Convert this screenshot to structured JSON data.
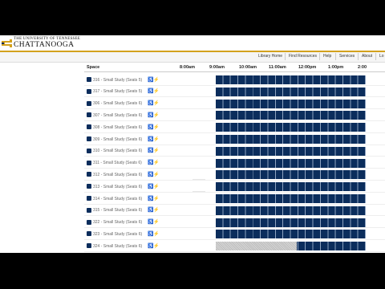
{
  "logo": {
    "top_text": "THE UNIVERSITY OF TENNESSEE",
    "main_text": "CHATTANOOGA",
    "brand_color": "#d3a11d",
    "mark_icon": "power-c-icon"
  },
  "nav": {
    "items": [
      "Library Home",
      "Find Resources",
      "Help",
      "Services",
      "About",
      "Lo"
    ]
  },
  "grid": {
    "space_header": "Space",
    "times": [
      "8:00am",
      "9:00am",
      "10:00am",
      "11:00am",
      "12:00pm",
      "1:00pm",
      "2:00"
    ],
    "booked_color": "#0b2d5c",
    "rows": [
      {
        "label": "316 - Small Study (Seats 5)",
        "state": "booked"
      },
      {
        "label": "317 - Small Study (Seats 5)",
        "state": "booked"
      },
      {
        "label": "306 - Small Study (Seats 6)",
        "state": "booked"
      },
      {
        "label": "307 - Small Study (Seats 6)",
        "state": "booked"
      },
      {
        "label": "308 - Small Study (Seats 6)",
        "state": "booked"
      },
      {
        "label": "309 - Small Study (Seats 6)",
        "state": "booked"
      },
      {
        "label": "310 - Small Study (Seats 6)",
        "state": "booked"
      },
      {
        "label": "311 - Small Study (Seats 6)",
        "state": "booked"
      },
      {
        "label": "312 - Small Study (Seats 6)",
        "state": "booked"
      },
      {
        "label": "313 - Small Study (Seats 6)",
        "state": "booked"
      },
      {
        "label": "314 - Small Study (Seats 6)",
        "state": "booked"
      },
      {
        "label": "315 - Small Study (Seats 6)",
        "state": "booked"
      },
      {
        "label": "322 - Small Study (Seats 6)",
        "state": "booked"
      },
      {
        "label": "323 - Small Study (Seats 6)",
        "state": "booked"
      },
      {
        "label": "324 - Small Study (Seats 6)",
        "state": "partial"
      }
    ]
  }
}
